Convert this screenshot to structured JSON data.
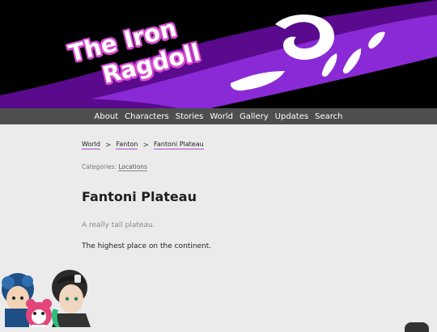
{
  "site": {
    "logo_line1": "The Iron",
    "logo_line2": "Ragdoll"
  },
  "nav": {
    "items": [
      "About",
      "Characters",
      "Stories",
      "World",
      "Gallery",
      "Updates",
      "Search"
    ]
  },
  "breadcrumb": {
    "items": [
      "World",
      "Fanton",
      "Fantoni Plateau"
    ],
    "separator": ">"
  },
  "categories": {
    "label": "Categories:",
    "items": [
      "Locations"
    ]
  },
  "page": {
    "title": "Fantoni Plateau",
    "subtitle": "A really tall plateau.",
    "body": "The highest place on the continent."
  },
  "colors": {
    "banner_bg": "#000000",
    "purple_dark": "#5a0a8c",
    "purple": "#8a2ad6",
    "accent_underline": "#a74ec2",
    "nav_bg": "#4e4e4e",
    "page_bg": "#ebebeb"
  }
}
